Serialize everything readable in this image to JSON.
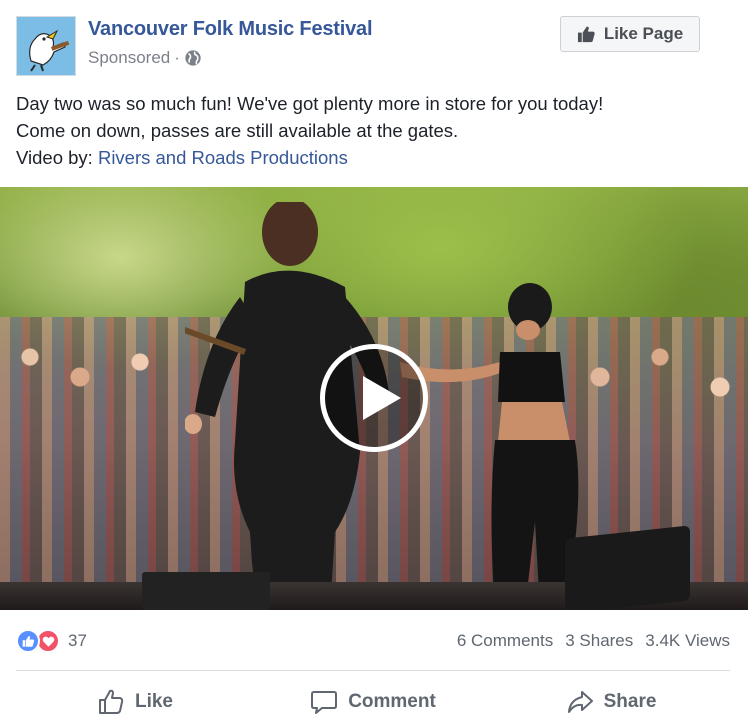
{
  "page": {
    "name": "Vancouver Folk Music Festival",
    "sponsored_label": "Sponsored",
    "meta_separator": "·",
    "like_page_label": "Like Page",
    "avatar_icon": "folk-festival-logo-icon"
  },
  "post": {
    "line1": "Day two was so much fun! We've got plenty more in store for you today!",
    "line2": "Come on down, passes are still available at the gates.",
    "credit_prefix": "Video by: ",
    "credit_link": "Rivers and Roads Productions"
  },
  "video": {
    "play_icon": "play-icon"
  },
  "stats": {
    "reaction_count": "37",
    "comments": "6 Comments",
    "shares": "3 Shares",
    "views": "3.4K Views"
  },
  "actions": {
    "like": "Like",
    "comment": "Comment",
    "share": "Share"
  },
  "colors": {
    "link": "#365899",
    "like_reaction": "#5890ff",
    "love_reaction": "#f25268",
    "muted_text": "#606770"
  }
}
